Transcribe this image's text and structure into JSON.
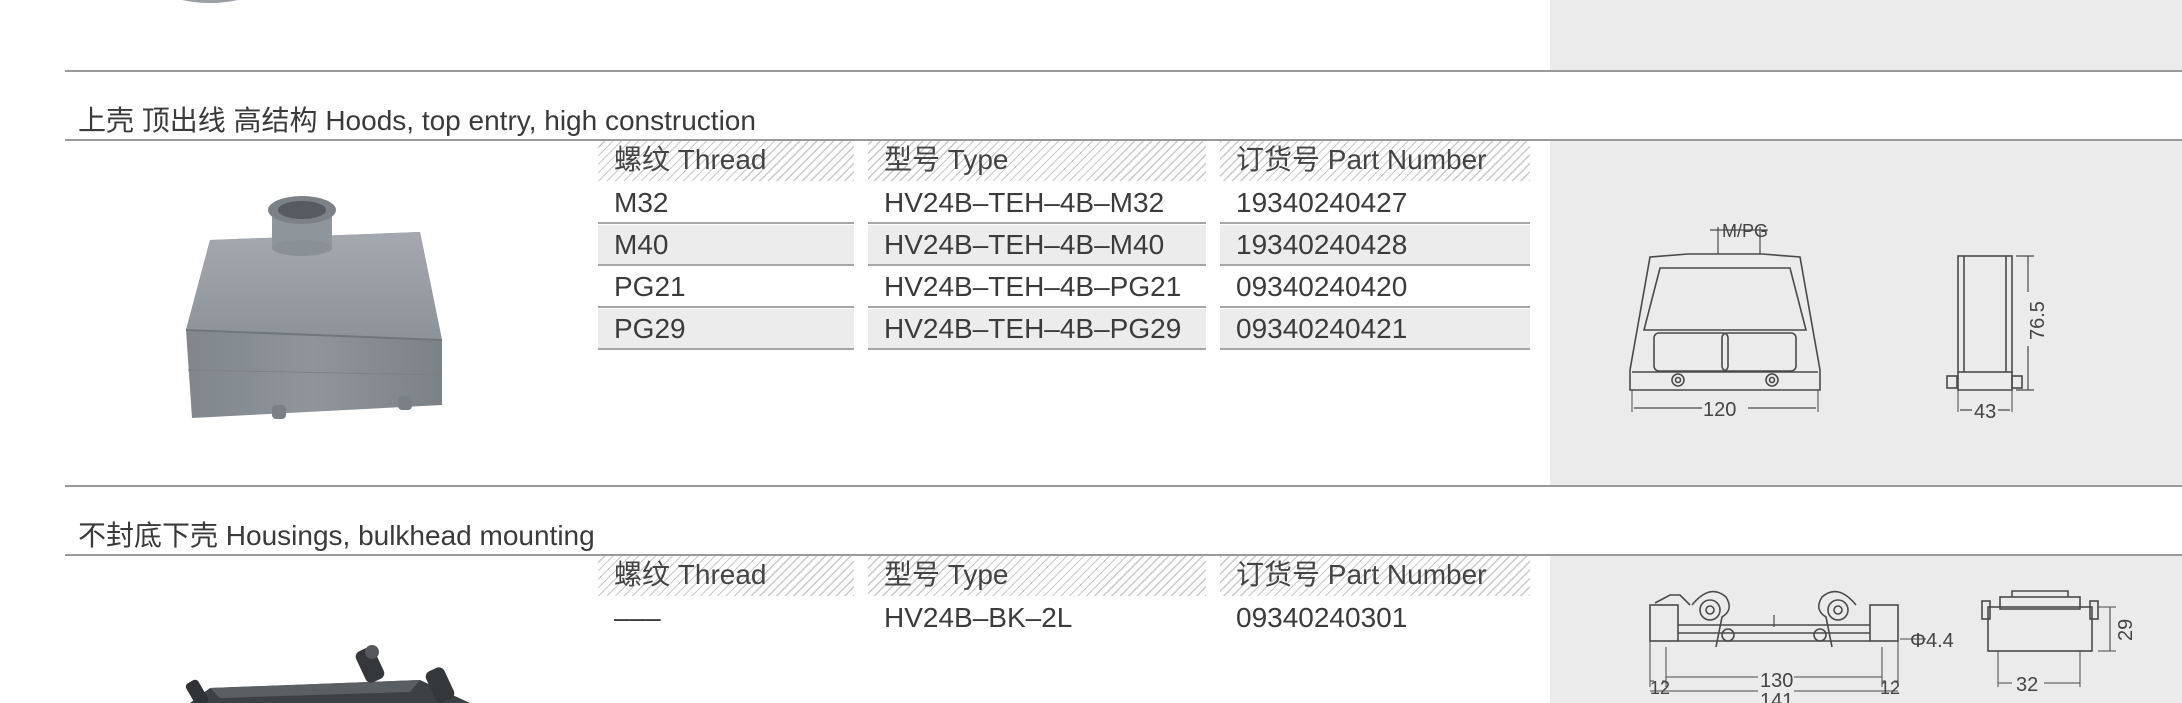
{
  "sections": [
    {
      "title": "上壳 顶出线 高结构 Hoods, top entry, high construction",
      "headers": {
        "thread": "螺纹 Thread",
        "type": "型号 Type",
        "part": "订货号 Part Number"
      },
      "rows": [
        {
          "thread": "M32",
          "type": "HV24B–TEH–4B–M32",
          "part": "19340240427"
        },
        {
          "thread": "M40",
          "type": "HV24B–TEH–4B–M40",
          "part": "19340240428"
        },
        {
          "thread": "PG21",
          "type": "HV24B–TEH–4B–PG21",
          "part": "09340240420"
        },
        {
          "thread": "PG29",
          "type": "HV24B–TEH–4B–PG29",
          "part": "09340240421"
        }
      ],
      "drawing": {
        "label_thread": "M/PG",
        "dim_height": "76.5",
        "dim_width": "120",
        "dim_depth": "43"
      }
    },
    {
      "title": "不封底下壳 Housings, bulkhead mounting",
      "headers": {
        "thread": "螺纹 Thread",
        "type": "型号 Type",
        "part": "订货号 Part Number"
      },
      "rows": [
        {
          "thread": "–––",
          "type": "HV24B–BK–2L",
          "part": "09340240301"
        }
      ],
      "drawing": {
        "dim_hole": "Φ4.4",
        "dim_height": "29",
        "dim_left": "12",
        "dim_inner": "130",
        "dim_outer": "141",
        "dim_right": "12",
        "dim_depth": "32"
      }
    }
  ]
}
